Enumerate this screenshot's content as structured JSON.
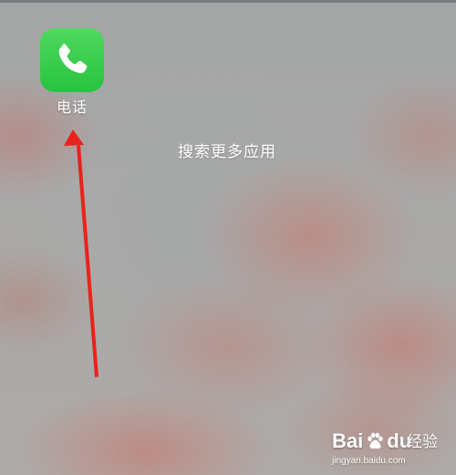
{
  "home_screen": {
    "apps": [
      {
        "label": "电话",
        "icon": "phone-icon",
        "icon_color": "#34c94a"
      }
    ],
    "search_more_label": "搜索更多应用"
  },
  "annotation": {
    "arrow_color": "#e8231c"
  },
  "watermark": {
    "brand_left": "Bai",
    "brand_right": "du",
    "paw_icon": "baidu-paw-icon",
    "product": "经验",
    "url": "jingyan.baidu.com"
  }
}
